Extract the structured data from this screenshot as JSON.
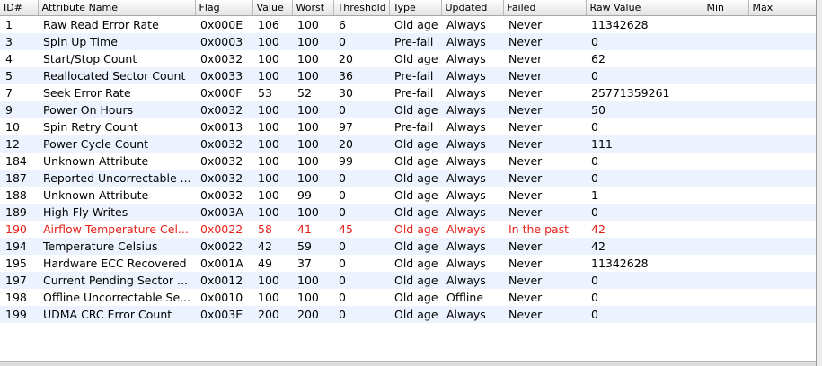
{
  "table": {
    "columns": [
      "ID#",
      "Attribute Name",
      "Flag",
      "Value",
      "Worst",
      "Threshold",
      "Type",
      "Updated",
      "Failed",
      "Raw Value",
      "Min",
      "Max"
    ],
    "rows": [
      {
        "id": "1",
        "name": "Raw Read Error Rate",
        "flag": "0x000E",
        "value": "106",
        "worst": "100",
        "threshold": "6",
        "type": "Old age",
        "updated": "Always",
        "failed": "Never",
        "raw": "11342628",
        "min": "",
        "max": "",
        "warning": false
      },
      {
        "id": "3",
        "name": "Spin Up Time",
        "flag": "0x0003",
        "value": "100",
        "worst": "100",
        "threshold": "0",
        "type": "Pre-fail",
        "updated": "Always",
        "failed": "Never",
        "raw": "0",
        "min": "",
        "max": "",
        "warning": false
      },
      {
        "id": "4",
        "name": "Start/Stop Count",
        "flag": "0x0032",
        "value": "100",
        "worst": "100",
        "threshold": "20",
        "type": "Old age",
        "updated": "Always",
        "failed": "Never",
        "raw": "62",
        "min": "",
        "max": "",
        "warning": false
      },
      {
        "id": "5",
        "name": "Reallocated Sector Count",
        "flag": "0x0033",
        "value": "100",
        "worst": "100",
        "threshold": "36",
        "type": "Pre-fail",
        "updated": "Always",
        "failed": "Never",
        "raw": "0",
        "min": "",
        "max": "",
        "warning": false
      },
      {
        "id": "7",
        "name": "Seek Error Rate",
        "flag": "0x000F",
        "value": "53",
        "worst": "52",
        "threshold": "30",
        "type": "Pre-fail",
        "updated": "Always",
        "failed": "Never",
        "raw": "25771359261",
        "min": "",
        "max": "",
        "warning": false
      },
      {
        "id": "9",
        "name": "Power On Hours",
        "flag": "0x0032",
        "value": "100",
        "worst": "100",
        "threshold": "0",
        "type": "Old age",
        "updated": "Always",
        "failed": "Never",
        "raw": "50",
        "min": "",
        "max": "",
        "warning": false
      },
      {
        "id": "10",
        "name": "Spin Retry Count",
        "flag": "0x0013",
        "value": "100",
        "worst": "100",
        "threshold": "97",
        "type": "Pre-fail",
        "updated": "Always",
        "failed": "Never",
        "raw": "0",
        "min": "",
        "max": "",
        "warning": false
      },
      {
        "id": "12",
        "name": "Power Cycle Count",
        "flag": "0x0032",
        "value": "100",
        "worst": "100",
        "threshold": "20",
        "type": "Old age",
        "updated": "Always",
        "failed": "Never",
        "raw": "111",
        "min": "",
        "max": "",
        "warning": false
      },
      {
        "id": "184",
        "name": "Unknown Attribute",
        "flag": "0x0032",
        "value": "100",
        "worst": "100",
        "threshold": "99",
        "type": "Old age",
        "updated": "Always",
        "failed": "Never",
        "raw": "0",
        "min": "",
        "max": "",
        "warning": false
      },
      {
        "id": "187",
        "name": "Reported Uncorrectable ...",
        "flag": "0x0032",
        "value": "100",
        "worst": "100",
        "threshold": "0",
        "type": "Old age",
        "updated": "Always",
        "failed": "Never",
        "raw": "0",
        "min": "",
        "max": "",
        "warning": false
      },
      {
        "id": "188",
        "name": "Unknown Attribute",
        "flag": "0x0032",
        "value": "100",
        "worst": "99",
        "threshold": "0",
        "type": "Old age",
        "updated": "Always",
        "failed": "Never",
        "raw": "1",
        "min": "",
        "max": "",
        "warning": false
      },
      {
        "id": "189",
        "name": "High Fly Writes",
        "flag": "0x003A",
        "value": "100",
        "worst": "100",
        "threshold": "0",
        "type": "Old age",
        "updated": "Always",
        "failed": "Never",
        "raw": "0",
        "min": "",
        "max": "",
        "warning": false
      },
      {
        "id": "190",
        "name": "Airflow Temperature Cel...",
        "flag": "0x0022",
        "value": "58",
        "worst": "41",
        "threshold": "45",
        "type": "Old age",
        "updated": "Always",
        "failed": "In the past",
        "raw": "42",
        "min": "",
        "max": "",
        "warning": true
      },
      {
        "id": "194",
        "name": "Temperature Celsius",
        "flag": "0x0022",
        "value": "42",
        "worst": "59",
        "threshold": "0",
        "type": "Old age",
        "updated": "Always",
        "failed": "Never",
        "raw": "42",
        "min": "",
        "max": "",
        "warning": false
      },
      {
        "id": "195",
        "name": "Hardware ECC Recovered",
        "flag": "0x001A",
        "value": "49",
        "worst": "37",
        "threshold": "0",
        "type": "Old age",
        "updated": "Always",
        "failed": "Never",
        "raw": "11342628",
        "min": "",
        "max": "",
        "warning": false
      },
      {
        "id": "197",
        "name": "Current Pending Sector ...",
        "flag": "0x0012",
        "value": "100",
        "worst": "100",
        "threshold": "0",
        "type": "Old age",
        "updated": "Always",
        "failed": "Never",
        "raw": "0",
        "min": "",
        "max": "",
        "warning": false
      },
      {
        "id": "198",
        "name": "Offline Uncorrectable Se...",
        "flag": "0x0010",
        "value": "100",
        "worst": "100",
        "threshold": "0",
        "type": "Old age",
        "updated": "Offline",
        "failed": "Never",
        "raw": "0",
        "min": "",
        "max": "",
        "warning": false
      },
      {
        "id": "199",
        "name": "UDMA CRC Error Count",
        "flag": "0x003E",
        "value": "200",
        "worst": "200",
        "threshold": "0",
        "type": "Old age",
        "updated": "Always",
        "failed": "Never",
        "raw": "0",
        "min": "",
        "max": "",
        "warning": false
      }
    ],
    "empty_rows": 1
  },
  "colors": {
    "header_bg": "#e4e4e4",
    "row_even": "#ffffff",
    "row_odd": "#edf3fe",
    "warning_text": "#e8201a"
  }
}
